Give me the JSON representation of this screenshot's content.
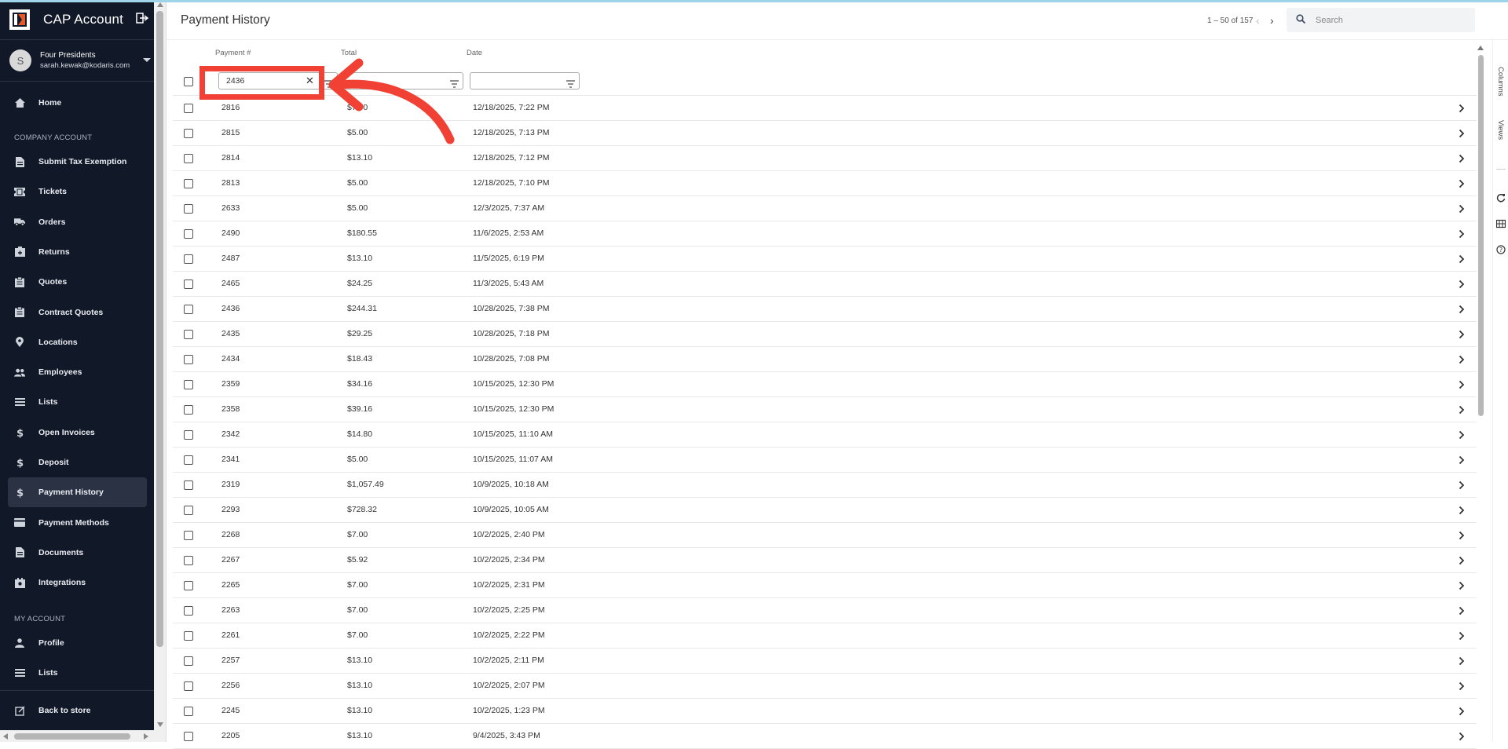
{
  "app": {
    "title": "CAP Account"
  },
  "user": {
    "initial": "S",
    "name": "Four Presidents",
    "email": "sarah.kewak@kodaris.com"
  },
  "sidebar": {
    "home": "Home",
    "company_section": "COMPANY ACCOUNT",
    "company_items": [
      {
        "label": "Submit Tax Exemption",
        "icon": "document-icon"
      },
      {
        "label": "Tickets",
        "icon": "ticket-icon"
      },
      {
        "label": "Orders",
        "icon": "truck-icon"
      },
      {
        "label": "Returns",
        "icon": "return-box-icon"
      },
      {
        "label": "Quotes",
        "icon": "clipboard-icon"
      },
      {
        "label": "Contract Quotes",
        "icon": "clipboard-icon"
      },
      {
        "label": "Locations",
        "icon": "location-pin-icon"
      },
      {
        "label": "Employees",
        "icon": "people-icon"
      },
      {
        "label": "Lists",
        "icon": "list-icon"
      },
      {
        "label": "Open Invoices",
        "icon": "dollar-icon"
      },
      {
        "label": "Deposit",
        "icon": "dollar-icon"
      },
      {
        "label": "Payment History",
        "icon": "dollar-icon"
      },
      {
        "label": "Payment Methods",
        "icon": "credit-card-icon"
      },
      {
        "label": "Documents",
        "icon": "document-icon"
      },
      {
        "label": "Integrations",
        "icon": "integrations-icon"
      }
    ],
    "active_item": "Payment History",
    "my_section": "MY ACCOUNT",
    "my_items": [
      {
        "label": "Profile",
        "icon": "person-icon"
      },
      {
        "label": "Lists",
        "icon": "list-icon"
      }
    ],
    "back_to_store": "Back to store"
  },
  "header": {
    "title": "Payment History",
    "pager": "1 – 50 of 157",
    "search_placeholder": "Search"
  },
  "table": {
    "columns": [
      "Payment #",
      "Total",
      "Date"
    ],
    "filters": {
      "payment_number": "2436",
      "total": "",
      "date": ""
    },
    "rows": [
      [
        "2816",
        "$7.00",
        "12/18/2025, 7:22 PM"
      ],
      [
        "2815",
        "$5.00",
        "12/18/2025, 7:13 PM"
      ],
      [
        "2814",
        "$13.10",
        "12/18/2025, 7:12 PM"
      ],
      [
        "2813",
        "$5.00",
        "12/18/2025, 7:10 PM"
      ],
      [
        "2633",
        "$5.00",
        "12/3/2025, 7:37 AM"
      ],
      [
        "2490",
        "$180.55",
        "11/6/2025, 2:53 AM"
      ],
      [
        "2487",
        "$13.10",
        "11/5/2025, 6:19 PM"
      ],
      [
        "2465",
        "$24.25",
        "11/3/2025, 5:43 AM"
      ],
      [
        "2436",
        "$244.31",
        "10/28/2025, 7:38 PM"
      ],
      [
        "2435",
        "$29.25",
        "10/28/2025, 7:18 PM"
      ],
      [
        "2434",
        "$18.43",
        "10/28/2025, 7:08 PM"
      ],
      [
        "2359",
        "$34.16",
        "10/15/2025, 12:30 PM"
      ],
      [
        "2358",
        "$39.16",
        "10/15/2025, 12:30 PM"
      ],
      [
        "2342",
        "$14.80",
        "10/15/2025, 11:10 AM"
      ],
      [
        "2341",
        "$5.00",
        "10/15/2025, 11:07 AM"
      ],
      [
        "2319",
        "$1,057.49",
        "10/9/2025, 10:18 AM"
      ],
      [
        "2293",
        "$728.32",
        "10/9/2025, 10:05 AM"
      ],
      [
        "2268",
        "$7.00",
        "10/2/2025, 2:40 PM"
      ],
      [
        "2267",
        "$5.92",
        "10/2/2025, 2:34 PM"
      ],
      [
        "2265",
        "$7.00",
        "10/2/2025, 2:31 PM"
      ],
      [
        "2263",
        "$7.00",
        "10/2/2025, 2:25 PM"
      ],
      [
        "2261",
        "$7.00",
        "10/2/2025, 2:22 PM"
      ],
      [
        "2257",
        "$13.10",
        "10/2/2025, 2:11 PM"
      ],
      [
        "2256",
        "$13.10",
        "10/2/2025, 2:07 PM"
      ],
      [
        "2245",
        "$13.10",
        "10/2/2025, 1:23 PM"
      ],
      [
        "2205",
        "$13.10",
        "9/4/2025, 3:43 PM"
      ]
    ]
  },
  "right_rail": {
    "columns": "Columns",
    "views": "Views"
  },
  "colors": {
    "sidebar_bg": "#111827",
    "annotation_red": "#f04134",
    "brand_orange": "#e8572a"
  }
}
